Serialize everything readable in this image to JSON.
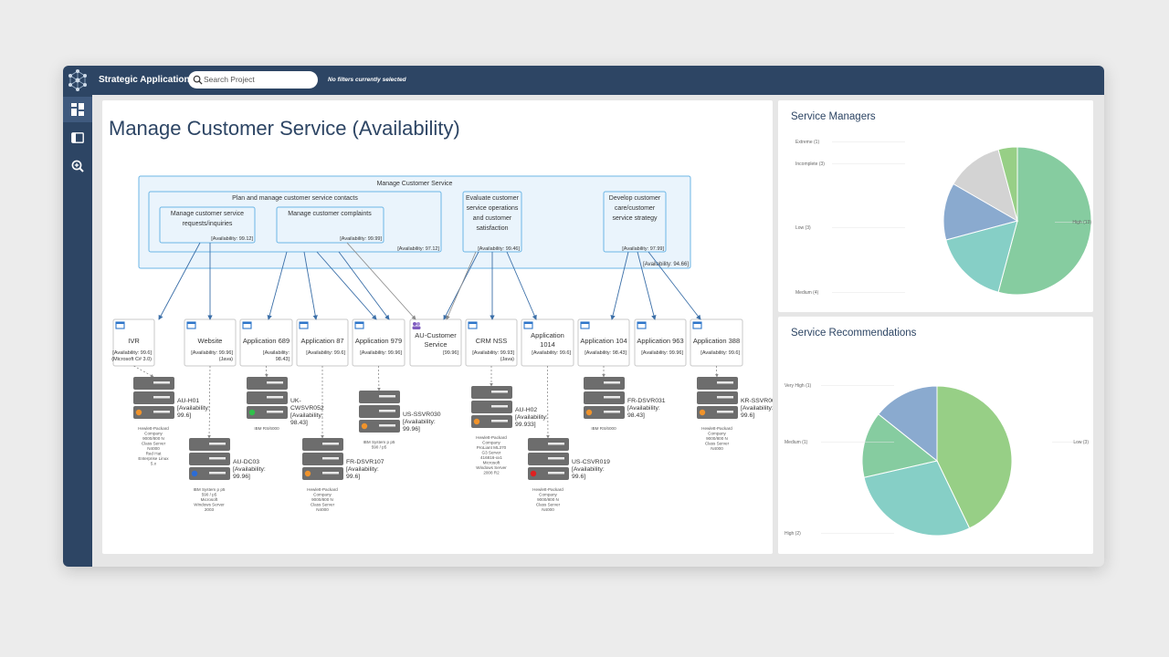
{
  "header": {
    "app_title": "Strategic Application",
    "search_placeholder": "Search Project",
    "filter_status": "No filters currently selected"
  },
  "sidebar": {
    "items": [
      {
        "icon": "dashboard-icon",
        "active": true
      },
      {
        "icon": "panel-icon",
        "active": false
      },
      {
        "icon": "zoom-icon",
        "active": false
      }
    ]
  },
  "main": {
    "title": "Manage Customer Service (Availability)"
  },
  "diagram": {
    "outer": {
      "label": "Manage Customer Service",
      "availability": "[Availability: 94.66]"
    },
    "groups": [
      {
        "label": "Plan and manage customer service contacts",
        "availability": "[Availability: 97.12]"
      },
      {
        "lines": [
          "Evaluate customer",
          "service operations",
          "and customer",
          "satisfaction"
        ],
        "availability": "[Availability: 99.46]"
      },
      {
        "lines": [
          "Develop customer",
          "care/customer",
          "service strategy"
        ],
        "availability": "[Availability: 97.99]"
      }
    ],
    "subprocesses": [
      {
        "lines": [
          "Manage customer service",
          "requests/inquiries"
        ],
        "availability": "[Availability: 99.12]"
      },
      {
        "lines": [
          "Manage customer complaints"
        ],
        "availability": "[Availability: 99.99]"
      }
    ],
    "apps": [
      {
        "lines": [
          "IVR"
        ],
        "foot": [
          "[Availability: 99.6]",
          "(Microsoft C# 3.0)"
        ],
        "icon": "window"
      },
      {
        "lines": [
          "Website"
        ],
        "foot": [
          "[Availability: 99.96]",
          "(Java)"
        ],
        "icon": "window"
      },
      {
        "lines": [
          "Application 689"
        ],
        "foot": [
          "[Availability:",
          "98.43]"
        ],
        "icon": "window"
      },
      {
        "lines": [
          "Application 87"
        ],
        "foot": [
          "[Availability: 99.6]"
        ],
        "icon": "window"
      },
      {
        "lines": [
          "Application 979"
        ],
        "foot": [
          "[Availability: 99.96]"
        ],
        "icon": "window"
      },
      {
        "lines": [
          "AU-Customer",
          "Service"
        ],
        "foot": [
          "[99.96]"
        ],
        "icon": "team"
      },
      {
        "lines": [
          "CRM NSS"
        ],
        "foot": [
          "[Availability: 99.93]",
          "(Java)"
        ],
        "icon": "window"
      },
      {
        "lines": [
          "Application",
          "1014"
        ],
        "foot": [
          "[Availability: 99.6]"
        ],
        "icon": "window"
      },
      {
        "lines": [
          "Application 104"
        ],
        "foot": [
          "[Availability: 98.43]"
        ],
        "icon": "window"
      },
      {
        "lines": [
          "Application 963"
        ],
        "foot": [
          "[Availability: 99.96]"
        ],
        "icon": "window"
      },
      {
        "lines": [
          "Application 388"
        ],
        "foot": [
          "[Availability: 99.6]"
        ],
        "icon": "window"
      }
    ],
    "servers": [
      {
        "label": [
          "AU-H01",
          "[Availability:",
          "99.6]"
        ],
        "status": "#f0932b",
        "notes": [
          "Hewlett-Packard",
          "Company",
          "9000/800 N",
          "Class Server",
          "N4000",
          "Red Hat",
          "Enterprise Linux",
          "5.x"
        ]
      },
      {
        "label": [
          "AU-DC03",
          "[Availability:",
          "99.96]"
        ],
        "status": "#2b6cd6",
        "notes": [
          "IBM System p p5",
          "590 / p5",
          "Microsoft",
          "Windows Server",
          "2003"
        ]
      },
      {
        "label": [
          "UK-",
          "CWSVR052",
          "[Availability:",
          "98.43]"
        ],
        "status": "#2fbf4a",
        "notes": [
          "IBM RS/6000"
        ]
      },
      {
        "label": [
          "FR-DSVR107",
          "[Availability:",
          "99.6]"
        ],
        "status": "#f0932b",
        "notes": [
          "Hewlett-Packard",
          "Company",
          "9000/800 N",
          "Class Server",
          "N4000"
        ]
      },
      {
        "label": [
          "US-SSVR030",
          "[Availability:",
          "99.96]"
        ],
        "status": "#f0932b",
        "notes": [
          "IBM System p p5",
          "590 / p5"
        ]
      },
      {
        "label": [
          "AU-H02",
          "[Availability:",
          "99.933]"
        ],
        "status": "#f0932b",
        "notes": [
          "Hewlett-Packard",
          "Company",
          "ProLiant ML370",
          "G3 Server",
          "416816-xx1",
          "Microsoft",
          "Windows Server",
          "2008 R2"
        ]
      },
      {
        "label": [
          "US-CSVR019",
          "[Availability:",
          "99.6]"
        ],
        "status": "#e02020",
        "notes": [
          "Hewlett-Packard",
          "Company",
          "9000/800 N",
          "Class Server",
          "N4000"
        ]
      },
      {
        "label": [
          "FR-DSVR031",
          "[Availability:",
          "98.43]"
        ],
        "status": "#f0932b",
        "notes": [
          "IBM RS/6000"
        ]
      },
      {
        "label": [
          "KR-SSVR005",
          "[Availability:",
          "99.6]"
        ],
        "status": "#f0932b",
        "notes": [
          "Hewlett-Packard",
          "Company",
          "9000/800 N",
          "Class Server",
          "N4000"
        ]
      }
    ]
  },
  "charts": {
    "service_managers_title": "Service Managers",
    "service_recommendations_title": "Service Recommendations"
  },
  "chart_data": [
    {
      "type": "pie",
      "title": "Service Managers",
      "categories": [
        "High",
        "Medium",
        "Low",
        "Incomplete",
        "Extreme"
      ],
      "labels": [
        "High (13)",
        "Medium (4)",
        "Low (3)",
        "Incomplete (3)",
        "Extreme (1)"
      ],
      "values": [
        13,
        4,
        3,
        3,
        1
      ],
      "colors": [
        "#86cca0",
        "#86cfc6",
        "#8aaacf",
        "#d3d3d3",
        "#97cf86"
      ]
    },
    {
      "type": "pie",
      "title": "Service Recommendations",
      "categories": [
        "Low",
        "High",
        "Medium",
        "Very High"
      ],
      "labels": [
        "Low (3)",
        "High (2)",
        "Medium (1)",
        "Very High (1)"
      ],
      "values": [
        3,
        2,
        1,
        1
      ],
      "colors": [
        "#97cf86",
        "#86cfc6",
        "#86cca0",
        "#8aaacf"
      ]
    }
  ]
}
